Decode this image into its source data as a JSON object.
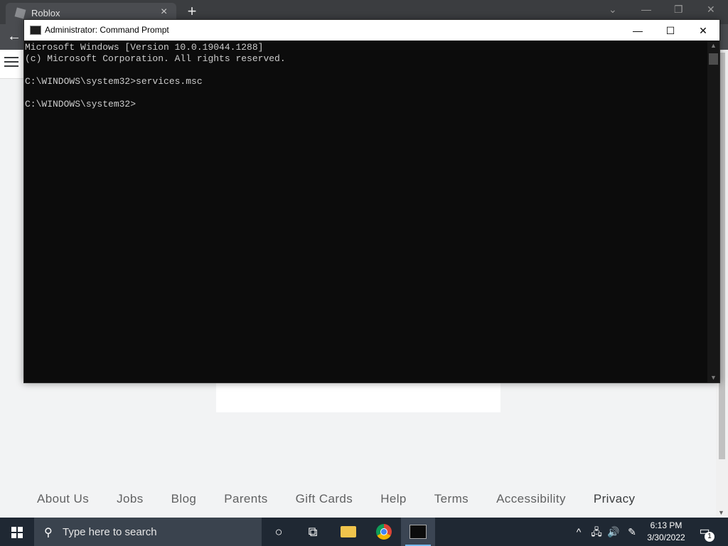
{
  "browser": {
    "tab_title": "Roblox",
    "tab_close": "×",
    "new_tab": "+",
    "controls": {
      "chevron": "⌄",
      "minimize": "—",
      "restore": "❐",
      "close": "✕"
    },
    "back": "←"
  },
  "page": {
    "footer_links": [
      "About Us",
      "Jobs",
      "Blog",
      "Parents",
      "Gift Cards",
      "Help",
      "Terms",
      "Accessibility",
      "Privacy"
    ]
  },
  "cmd": {
    "title": "Administrator: Command Prompt",
    "controls": {
      "minimize": "—",
      "maximize": "☐",
      "close": "✕"
    },
    "output": "Microsoft Windows [Version 10.0.19044.1288]\n(c) Microsoft Corporation. All rights reserved.\n\nC:\\WINDOWS\\system32>services.msc\n\nC:\\WINDOWS\\system32>"
  },
  "taskbar": {
    "search_placeholder": "Type here to search",
    "tray": {
      "chevron": "^",
      "network": "🖧",
      "volume": "🔊",
      "pen": "✎"
    },
    "time": "6:13 PM",
    "date": "3/30/2022",
    "notification_count": "1"
  },
  "icons": {
    "search": "⚲",
    "cortana": "○",
    "task_view": "⧉"
  }
}
